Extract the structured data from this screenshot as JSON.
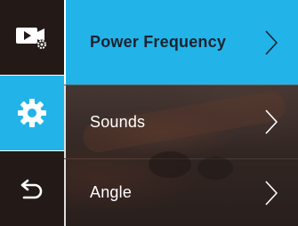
{
  "rail": {
    "items": [
      {
        "icon": "video-settings-icon",
        "active": false
      },
      {
        "icon": "gear-icon",
        "active": true
      },
      {
        "icon": "back-arrow-icon",
        "active": false
      }
    ]
  },
  "menu": {
    "items": [
      {
        "label": "Power Frequency",
        "selected": true
      },
      {
        "label": "Sounds",
        "selected": false
      },
      {
        "label": "Angle",
        "selected": false
      }
    ]
  },
  "colors": {
    "accent": "#22b4e8",
    "rail_dark": "#231a18",
    "selected_text": "#1c2230",
    "text": "#ffffff"
  }
}
